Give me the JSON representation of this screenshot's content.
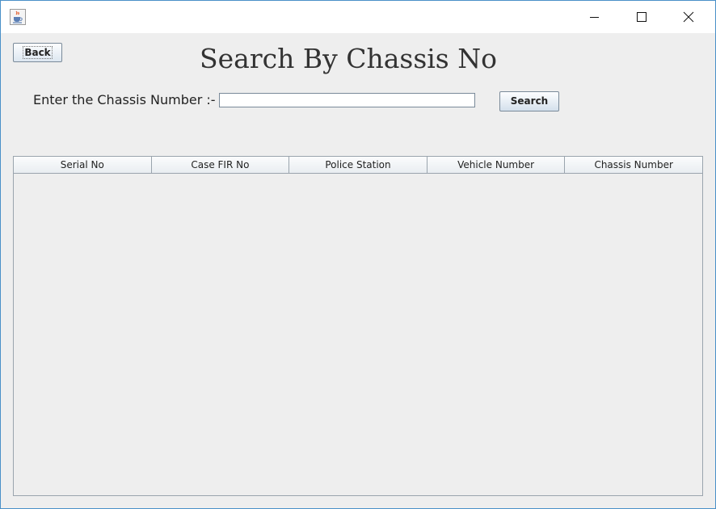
{
  "window": {
    "icon": "java-cup-icon",
    "controls": [
      "minimize-icon",
      "maximize-icon",
      "close-icon"
    ]
  },
  "toolbar": {
    "back_label": "Back"
  },
  "page": {
    "title": "Search By Chassis No"
  },
  "search": {
    "label": "Enter the Chassis Number :-",
    "value": "",
    "button_label": "Search"
  },
  "table": {
    "columns": [
      "Serial No",
      "Case FIR No",
      "Police Station",
      "Vehicle Number",
      "Chassis Number"
    ],
    "rows": []
  }
}
